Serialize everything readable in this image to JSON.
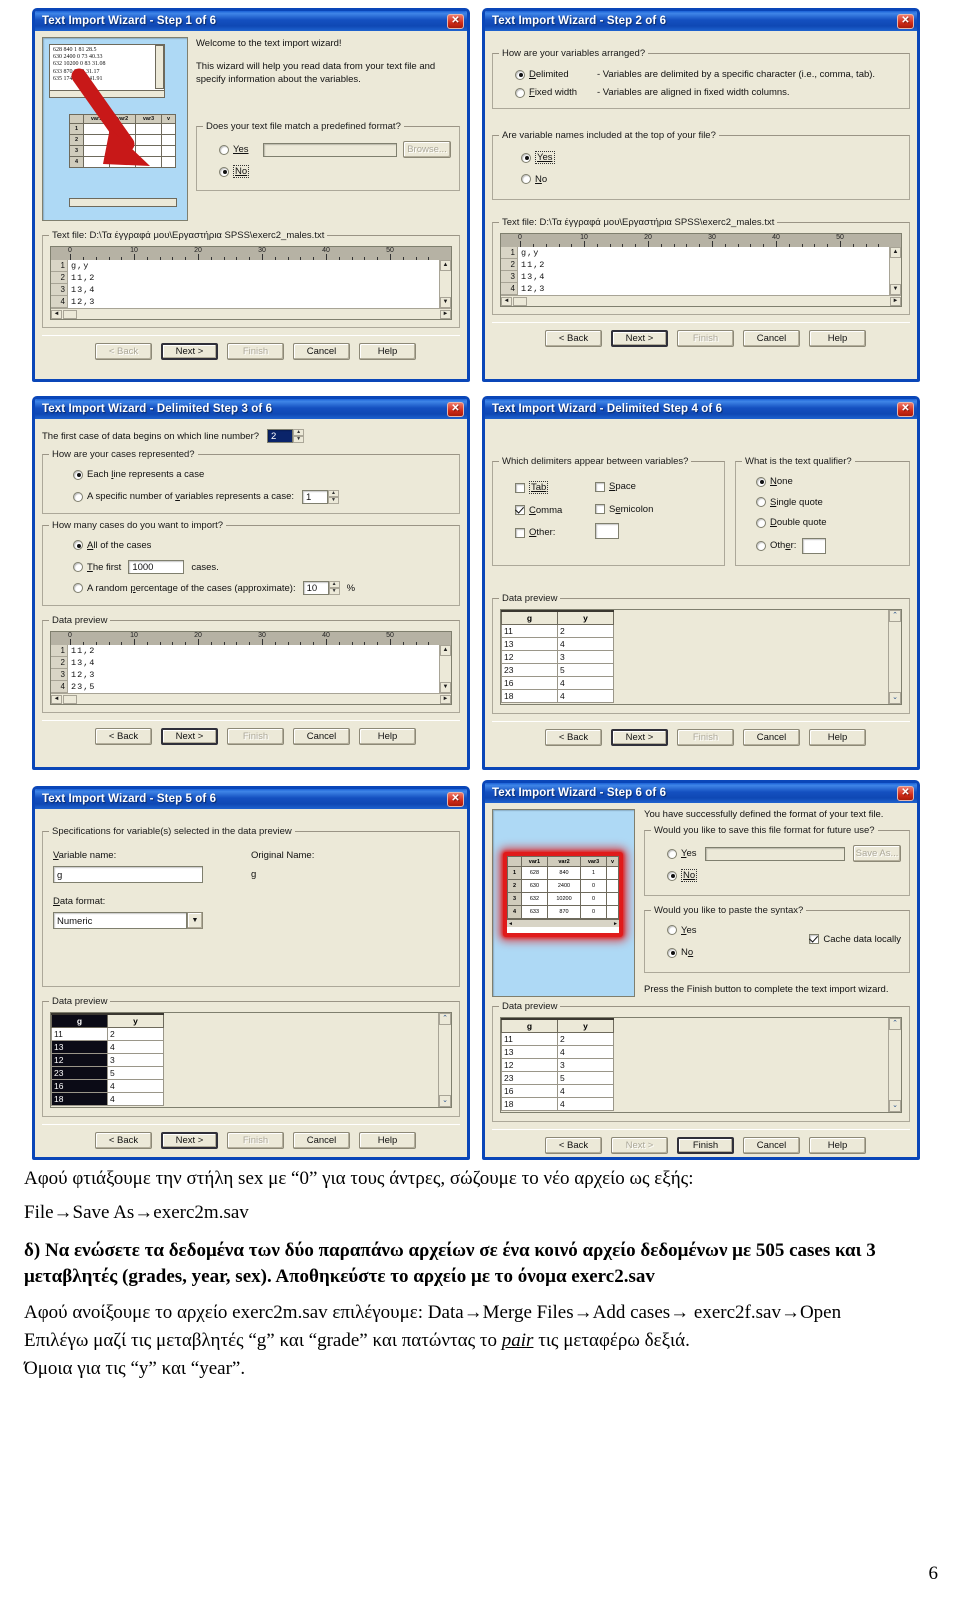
{
  "document": {
    "page_number": "6"
  },
  "common": {
    "buttons": {
      "back": "< Back",
      "next": "Next >",
      "finish": "Finish",
      "cancel": "Cancel",
      "help": "Help"
    },
    "data_preview_label": "Data preview",
    "text_file_label": "Text file: D:\\Τα έγγραφά μου\\Εργαστήρια SPSS\\exerc2_males.txt",
    "ruler_ticks": [
      "0",
      "10",
      "20",
      "30",
      "40",
      "50"
    ]
  },
  "step1": {
    "title": "Text Import Wizard - Step 1 of 6",
    "close": "✕",
    "welcome": "Welcome to the text import wizard!",
    "intro": "This wizard will help you read data from your text file and specify information about the variables.",
    "group_label": "Does your text file match a predefined format?",
    "radio_yes": "Yes",
    "radio_no": "No",
    "selected": "No",
    "browse": "Browse...",
    "path_value": "",
    "thumb_lines": [
      "628 840 1 81 28.5",
      "630 2400 0 73 40.33",
      "632 10200 0 83 31.08",
      "633 870 0 93 31.17",
      "635 1740 0 83 41.91"
    ],
    "thumb_headers": [
      "",
      "var1",
      "var2",
      "var3",
      "v"
    ],
    "thumb_rows": [
      "1",
      "2",
      "3",
      "4"
    ],
    "preview_gutter": [
      "1",
      "2",
      "3",
      "4"
    ],
    "preview_lines": [
      "g,y",
      "11,2",
      "13,4",
      "12,3"
    ]
  },
  "step2": {
    "title": "Text Import Wizard - Step 2 of 6",
    "close": "✕",
    "group1_label": "How are your variables arranged?",
    "opt_delimited": "Delimited",
    "opt_delimited_desc": "- Variables are delimited by a specific character (i.e., comma, tab).",
    "opt_fixed": "Fixed width",
    "opt_fixed_desc": "- Variables are aligned in fixed width columns.",
    "arrangement_selected": "Delimited",
    "group2_label": "Are variable names included at the top of your file?",
    "opt_yes": "Yes",
    "opt_no": "No",
    "names_selected": "Yes",
    "preview_gutter": [
      "1",
      "2",
      "3",
      "4"
    ],
    "preview_lines": [
      "g,y",
      "11,2",
      "13,4",
      "12,3"
    ]
  },
  "step3": {
    "title": "Text Import Wizard - Delimited Step 3 of 6",
    "close": "✕",
    "first_case_label": "The first case of data begins on which line number?",
    "first_case_value": "2",
    "group1_label": "How are your cases represented?",
    "opt_each_line": "Each line represents a case",
    "opt_specific": "A specific number of variables represents a case:",
    "specific_value": "1",
    "cases_selected": "Each line represents a case",
    "group2_label": "How many cases do you want to import?",
    "opt_all": "All of the cases",
    "opt_first": "The first",
    "first_value": "1000",
    "opt_first_suffix": "cases.",
    "opt_random": "A random percentage of the cases (approximate):",
    "random_value": "10",
    "percent_sign": "%",
    "import_selected": "All of the cases",
    "preview_gutter": [
      "1",
      "2",
      "3",
      "4"
    ],
    "preview_lines": [
      "11,2",
      "13,4",
      "12,3",
      "23,5"
    ]
  },
  "step4": {
    "title": "Text Import Wizard - Delimited Step 4 of 6",
    "close": "✕",
    "delim_group_label": "Which delimiters appear between variables?",
    "delimiters": [
      {
        "label": "Tab",
        "checked": false
      },
      {
        "label": "Space",
        "checked": false
      },
      {
        "label": "Comma",
        "checked": true
      },
      {
        "label": "Semicolon",
        "checked": false
      },
      {
        "label": "Other:",
        "checked": false
      }
    ],
    "other_value": "",
    "qualifier_group_label": "What is the text qualifier?",
    "qualifiers": [
      "None",
      "Single quote",
      "Double quote",
      "Other:"
    ],
    "qualifier_selected": "None",
    "qualifier_other_value": "",
    "preview_headers": [
      "g",
      "y"
    ],
    "preview_rows": [
      [
        "11",
        "2"
      ],
      [
        "13",
        "4"
      ],
      [
        "12",
        "3"
      ],
      [
        "23",
        "5"
      ],
      [
        "16",
        "4"
      ],
      [
        "18",
        "4"
      ]
    ]
  },
  "step5": {
    "title": "Text Import Wizard - Step 5 of 6",
    "close": "✕",
    "spec_group_label": "Specifications for variable(s) selected in the data preview",
    "variable_name_label": "Variable name:",
    "variable_name_value": "g",
    "original_name_label": "Original Name:",
    "original_name_value": "g",
    "data_format_label": "Data format:",
    "data_format_value": "Numeric",
    "preview_headers": [
      "g",
      "y"
    ],
    "preview_selected_column": "g",
    "preview_rows": [
      [
        "11",
        "2"
      ],
      [
        "13",
        "4"
      ],
      [
        "12",
        "3"
      ],
      [
        "23",
        "5"
      ],
      [
        "16",
        "4"
      ],
      [
        "18",
        "4"
      ]
    ]
  },
  "step6": {
    "title": "Text Import Wizard - Step 6 of 6",
    "close": "✕",
    "success_text": "You have successfully defined the format of your text file.",
    "save_group_label": "Would you like to save this file format for future use?",
    "save_yes": "Yes",
    "save_no": "No",
    "save_selected": "No",
    "save_as_button": "Save As...",
    "save_path_value": "",
    "paste_group_label": "Would you like to paste the syntax?",
    "paste_yes": "Yes",
    "paste_no": "No",
    "paste_selected": "No",
    "cache_label": "Cache data locally",
    "cache_checked": true,
    "finish_hint": "Press the Finish button to complete the text import wizard.",
    "thumb_headers": [
      "",
      "var1",
      "var2",
      "var3",
      "v"
    ],
    "thumb_rows": [
      [
        "1",
        "628",
        "840",
        "1",
        ""
      ],
      [
        "2",
        "630",
        "2400",
        "0",
        ""
      ],
      [
        "3",
        "632",
        "10200",
        "0",
        ""
      ],
      [
        "4",
        "633",
        "870",
        "0",
        ""
      ]
    ],
    "preview_headers": [
      "g",
      "y"
    ],
    "preview_rows": [
      [
        "11",
        "2"
      ],
      [
        "13",
        "4"
      ],
      [
        "12",
        "3"
      ],
      [
        "23",
        "5"
      ],
      [
        "16",
        "4"
      ],
      [
        "18",
        "4"
      ]
    ]
  },
  "body_text": {
    "line1": "Αφού φτιάξουμε την στήλη sex με “0” για τους άντρες, σώζουμε το νέο αρχείο ως εξής:",
    "line2": "File→Save As→exerc2m.sav",
    "line3_bold": "δ) Να ενώσετε τα δεδομένα των δύο παραπάνω αρχείων σε ένα κοινό αρχείο δεδομένων με 505 cases και 3 μεταβλητές (grades, year, sex). Αποθηκεύστε το αρχείο με το όνομα exerc2.sav",
    "line4": "Αφού ανοίξουμε το αρχείο exerc2m.sav επιλέγουμε: Data→Merge Files→Add cases→ exerc2f.sav→Open",
    "line5_a": "Επιλέγω μαζί τις μεταβλητές “g” και “grade” και πατώντας το ",
    "line5_link": "pair",
    "line5_b": " τις μεταφέρω δεξιά.",
    "line6": "Όμοια για τις “y” και “year”."
  }
}
